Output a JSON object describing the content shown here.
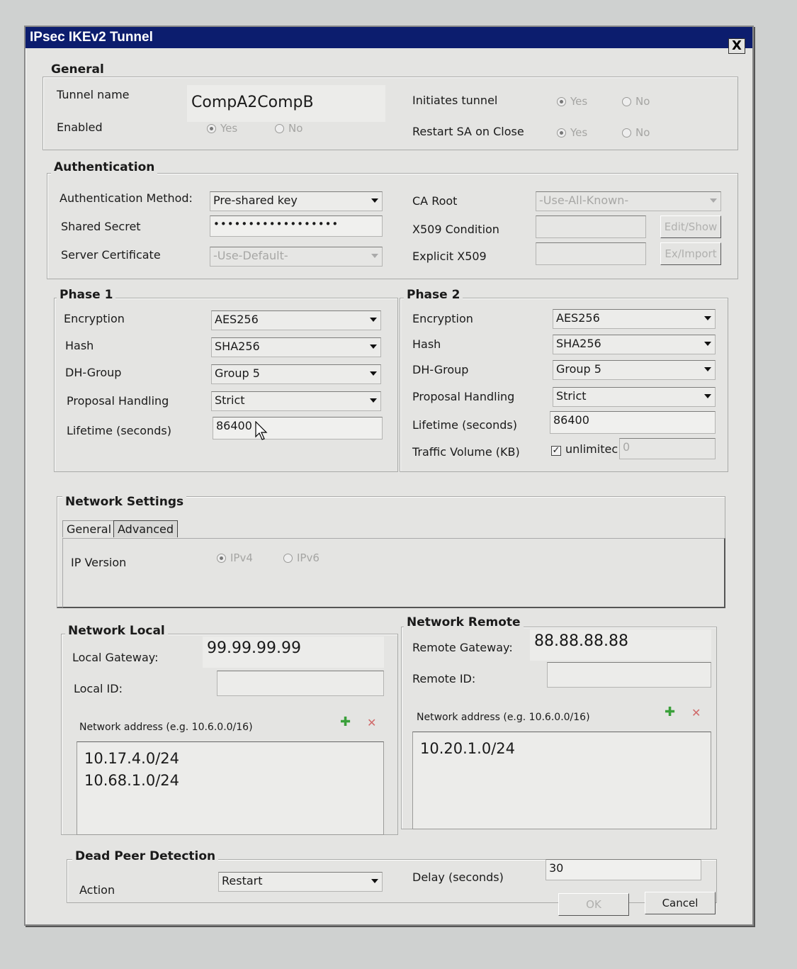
{
  "window": {
    "title": "IPsec IKEv2 Tunnel",
    "close_label": "X"
  },
  "general": {
    "legend": "General",
    "tunnel_name_label": "Tunnel name",
    "tunnel_name_value": "CompA2CompB",
    "enabled_label": "Enabled",
    "enabled_yes": "Yes",
    "enabled_no": "No",
    "initiates_label": "Initiates tunnel",
    "initiates_yes": "Yes",
    "initiates_no": "No",
    "restart_label": "Restart SA on Close",
    "restart_yes": "Yes",
    "restart_no": "No"
  },
  "auth": {
    "legend": "Authentication",
    "method_label": "Authentication Method:",
    "method_value": "Pre-shared key",
    "secret_label": "Shared Secret",
    "secret_value": "••••••••••••••••••",
    "cert_label": "Server Certificate",
    "cert_value": "-Use-Default-",
    "ca_label": "CA Root",
    "ca_value": "-Use-All-Known-",
    "x509_label": "X509 Condition",
    "edit_show": "Edit/Show",
    "explicit_label": "Explicit X509",
    "ex_import": "Ex/Import"
  },
  "phase1": {
    "legend": "Phase 1",
    "enc_label": "Encryption",
    "enc_value": "AES256",
    "hash_label": "Hash",
    "hash_value": "SHA256",
    "dh_label": "DH-Group",
    "dh_value": "Group 5",
    "prop_label": "Proposal Handling",
    "prop_value": "Strict",
    "life_label": "Lifetime (seconds)",
    "life_value": "86400"
  },
  "phase2": {
    "legend": "Phase 2",
    "enc_label": "Encryption",
    "enc_value": "AES256",
    "hash_label": "Hash",
    "hash_value": "SHA256",
    "dh_label": "DH-Group",
    "dh_value": "Group 5",
    "prop_label": "Proposal Handling",
    "prop_value": "Strict",
    "life_label": "Lifetime (seconds)",
    "life_value": "86400",
    "traffic_label": "Traffic Volume (KB)",
    "unlimited_label": "unlimitec",
    "traffic_value": "0"
  },
  "network": {
    "legend": "Network Settings",
    "tab_general": "General",
    "tab_advanced": "Advanced",
    "ip_version_label": "IP Version",
    "ipv4": "IPv4",
    "ipv6": "IPv6"
  },
  "local": {
    "legend": "Network Local",
    "gateway_label": "Local Gateway:",
    "gateway_value": "99.99.99.99",
    "id_label": "Local ID:",
    "list_header": "Network address (e.g. 10.6.0.0/16)",
    "networks": [
      "10.17.4.0/24",
      "10.68.1.0/24"
    ]
  },
  "remote": {
    "legend": "Network Remote",
    "gateway_label": "Remote Gateway:",
    "gateway_value": "88.88.88.88",
    "id_label": "Remote ID:",
    "list_header": "Network address (e.g. 10.6.0.0/16)",
    "networks": [
      "10.20.1.0/24"
    ]
  },
  "dpd": {
    "legend": "Dead Peer Detection",
    "action_label": "Action",
    "action_value": "Restart",
    "delay_label": "Delay (seconds)",
    "delay_value": "30"
  },
  "buttons": {
    "ok": "OK",
    "cancel": "Cancel"
  },
  "icons": {
    "add": "plus-icon",
    "remove": "x-icon",
    "cursor": "mouse-pointer-icon"
  }
}
